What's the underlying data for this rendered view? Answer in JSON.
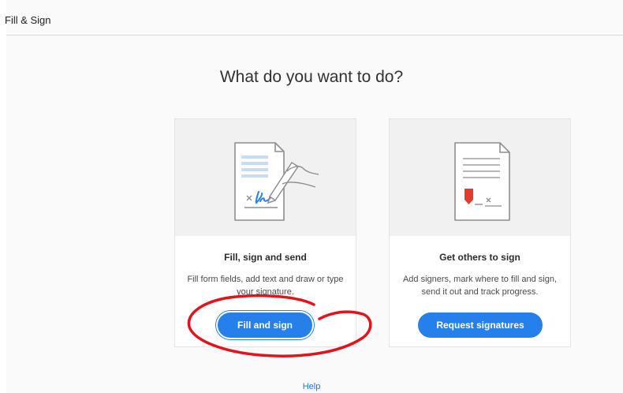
{
  "app": {
    "title": "Fill & Sign"
  },
  "main": {
    "heading": "What do you want to do?"
  },
  "cards": [
    {
      "title": "Fill, sign and send",
      "description": "Fill form fields, add text and draw or type your signature.",
      "button_label": "Fill and sign",
      "icon": "fill-sign-document-icon"
    },
    {
      "title": "Get others to sign",
      "description": "Add signers, mark where to fill and sign, send it out and track progress.",
      "button_label": "Request signatures",
      "icon": "request-signature-document-icon"
    }
  ],
  "footer": {
    "help_label": "Help"
  },
  "colors": {
    "accent": "#2680eb",
    "annotation": "#e3131b",
    "marker": "#e23b2f"
  }
}
